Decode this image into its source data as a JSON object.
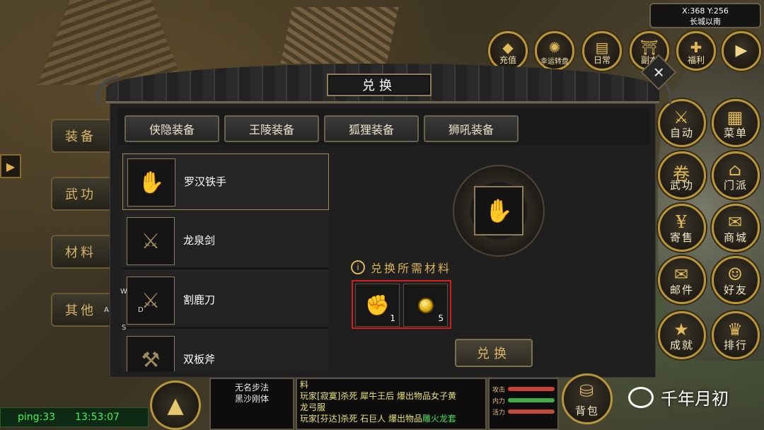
{
  "hud": {
    "coords": "X:368 Y:256",
    "location": "长城以南",
    "top_icons": [
      {
        "label": "充值",
        "icon": "treasure-bag-icon"
      },
      {
        "label": "幸运转盘",
        "icon": "wheel-icon"
      },
      {
        "label": "日常",
        "icon": "calendar-icon"
      },
      {
        "label": "副本",
        "icon": "gate-icon"
      },
      {
        "label": "福利",
        "icon": "gift-icon"
      }
    ],
    "expand_arrow": "▶"
  },
  "side_tabs": [
    "装备",
    "武功",
    "材料",
    "其他"
  ],
  "right_buttons": [
    {
      "label": "自动",
      "icon": "crossed-swords-icon",
      "glyph": "⚔"
    },
    {
      "label": "菜单",
      "icon": "grid-icon",
      "glyph": "▦"
    },
    {
      "label": "武功",
      "icon": "scroll-icon",
      "glyph": "卷"
    },
    {
      "label": "门派",
      "icon": "pavilion-icon",
      "glyph": "⌂"
    },
    {
      "label": "寄售",
      "icon": "money-bag-icon",
      "glyph": "¥"
    },
    {
      "label": "商城",
      "icon": "gift-box-icon",
      "glyph": "✉"
    },
    {
      "label": "邮件",
      "icon": "envelope-icon",
      "glyph": "✉"
    },
    {
      "label": "好友",
      "icon": "add-friend-icon",
      "glyph": "☺"
    },
    {
      "label": "成就",
      "icon": "badge-icon",
      "glyph": "★"
    },
    {
      "label": "排行",
      "icon": "ranking-icon",
      "glyph": "♛"
    }
  ],
  "dialog": {
    "title": "兑换",
    "tabs": [
      "侠隐装备",
      "王陵装备",
      "狐狸装备",
      "狮吼装备"
    ],
    "items": [
      {
        "name": "罗汉铁手",
        "icon": "iron-claw-icon",
        "glyph": "✋"
      },
      {
        "name": "龙泉剑",
        "icon": "sword-icon",
        "glyph": "⚔"
      },
      {
        "name": "割鹿刀",
        "icon": "blade-icon",
        "glyph": "⚔"
      },
      {
        "name": "双板斧",
        "icon": "axe-icon",
        "glyph": "⚒"
      }
    ],
    "required_label": "兑换所需材料",
    "materials": [
      {
        "icon": "gauntlet-icon",
        "qty": "1"
      },
      {
        "icon": "gold-coin-icon",
        "qty": "5"
      }
    ],
    "exchange_button": "兑换"
  },
  "status": {
    "ping": "ping:33",
    "time": "13:53:07"
  },
  "skills_panel": [
    "无名步法",
    "黑沙刚体"
  ],
  "chat": {
    "line0": "料",
    "line1_a": "玩家[寂寞]杀死 犀牛王后 爆出物品女子黄",
    "line1_b": "龙弓服",
    "line2_a": "玩家[芬达]杀死 石巨人 爆出物品",
    "line2_b": "雕火龙套"
  },
  "stats": [
    {
      "label": "攻击",
      "color": "#c9423a"
    },
    {
      "label": "内力",
      "color": "#3fae4a"
    },
    {
      "label": "活力",
      "color": "#c04a3e"
    }
  ],
  "bag": {
    "label": "背包"
  },
  "watermark": "千年月初",
  "joystick": {
    "w": "W",
    "a": "A",
    "s": "S",
    "d": "D"
  }
}
